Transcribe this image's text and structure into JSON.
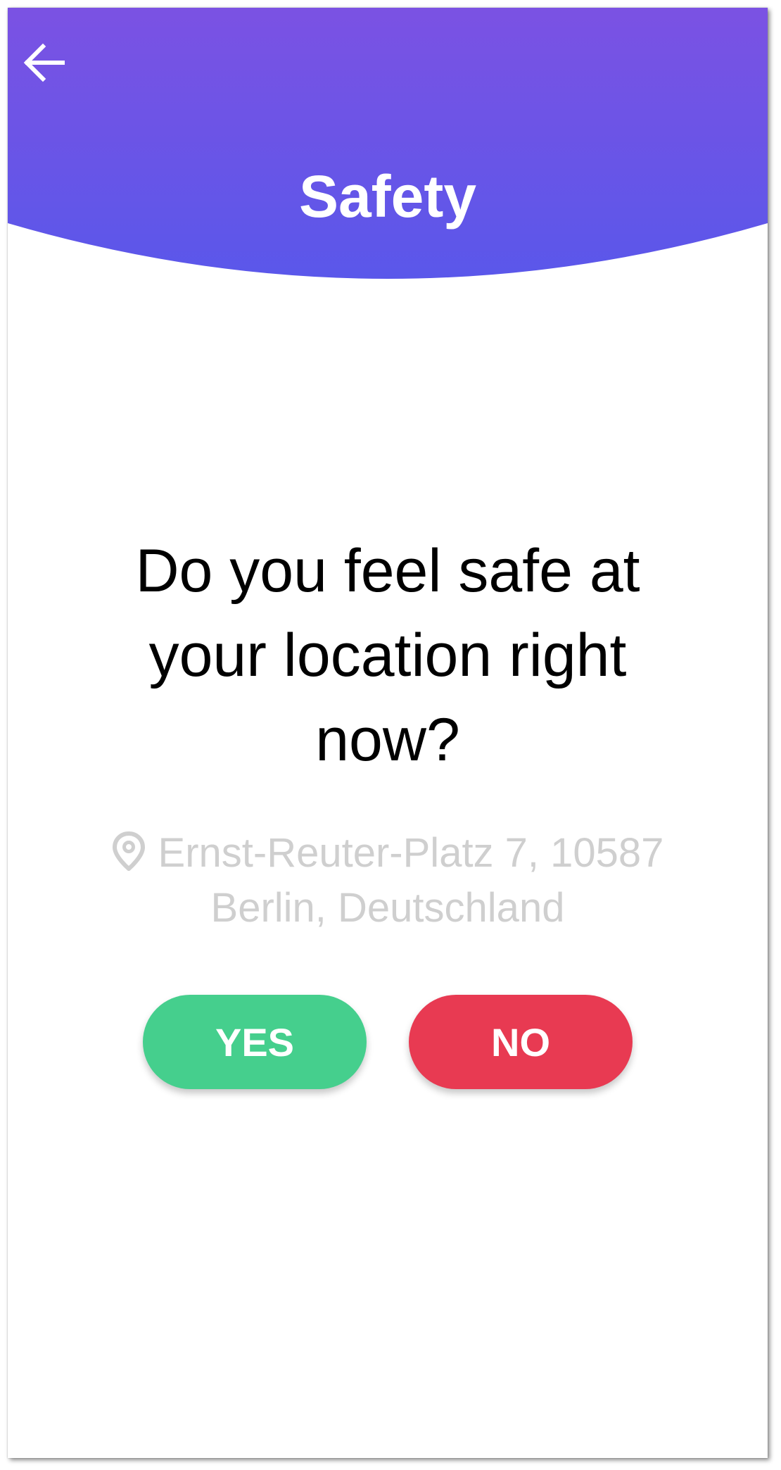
{
  "header": {
    "title": "Safety",
    "back_icon": "arrow-left-icon",
    "gradient_top": "#7b52e3",
    "gradient_bottom": "#5a57ea"
  },
  "question": {
    "text": "Do you feel safe at your location right now?"
  },
  "location": {
    "icon": "location-pin-icon",
    "address": "Ernst-Reuter-Platz 7, 10587 Berlin, Deutschland"
  },
  "actions": {
    "yes_label": "YES",
    "yes_color": "#45cf8d",
    "no_label": "NO",
    "no_color": "#e83a52"
  }
}
